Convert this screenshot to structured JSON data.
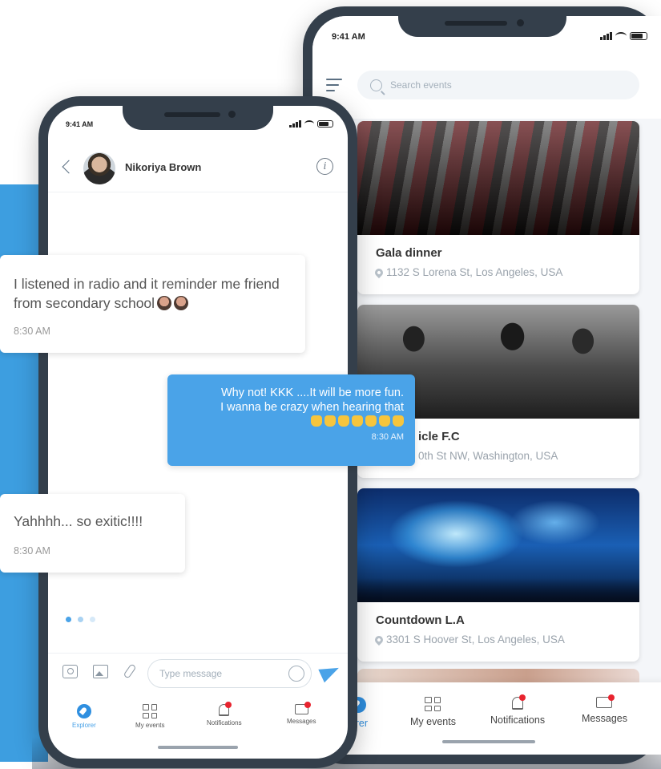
{
  "colors": {
    "accent": "#4aa3e8",
    "background_shape": "#3d9ee0",
    "phone_frame": "#343f4b",
    "notification_dot": "#e8232e"
  },
  "events_screen": {
    "status_time": "9:41 AM",
    "search": {
      "placeholder": "Search events",
      "icon": "search-icon"
    },
    "menu_icon": "menu-icon",
    "events": [
      {
        "title": "Gala dinner",
        "address": "1132 S Lorena St, Los Angeles, USA"
      },
      {
        "title": "icle F.C",
        "address": "0th St NW, Washington,  USA"
      },
      {
        "title": "Countdown L.A",
        "address": "3301 S Hoover St, Los Angeles, USA"
      }
    ],
    "tabs": [
      {
        "label": "lorer",
        "icon": "compass-icon"
      },
      {
        "label": "My events",
        "icon": "grid-icon"
      },
      {
        "label": "Notifications",
        "icon": "bell-icon"
      },
      {
        "label": "Messages",
        "icon": "chat-icon"
      }
    ]
  },
  "chat_screen": {
    "status_time": "9:41 AM",
    "contact_name": "Nikoriya Brown",
    "messages": [
      {
        "direction": "in",
        "text": "I listened in radio and it reminder me friend from secondary school",
        "time": "8:30 AM"
      },
      {
        "direction": "out",
        "text_line1": "Why not! KKK ....It will be more fun.",
        "text_line2": "I wanna be crazy when hearing that",
        "time": "8:30 AM"
      },
      {
        "direction": "in",
        "text": "Yahhhh... so exitic!!!!",
        "time": "8:30 AM"
      }
    ],
    "composer": {
      "placeholder": "Type message"
    },
    "tabs": [
      {
        "label": "Explorer",
        "icon": "compass-icon"
      },
      {
        "label": "My events",
        "icon": "grid-icon"
      },
      {
        "label": "Notifications",
        "icon": "bell-icon"
      },
      {
        "label": "Messages",
        "icon": "chat-icon"
      }
    ]
  }
}
